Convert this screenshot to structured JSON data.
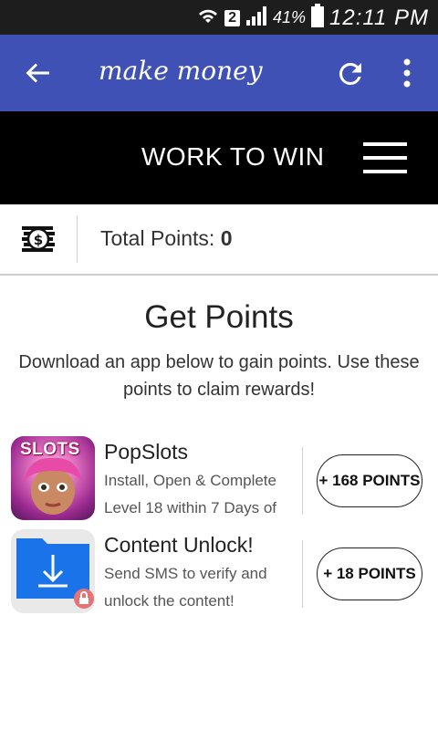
{
  "status_bar": {
    "sim": "2",
    "battery": "41%",
    "time": "12:11 PM",
    "icons": [
      "wifi-icon",
      "signal-icon",
      "battery-icon"
    ]
  },
  "app_bar": {
    "title": "make money",
    "color": "#3f51b5",
    "icons": [
      "back-arrow-icon",
      "refresh-icon",
      "more-vert-icon"
    ]
  },
  "banner": {
    "title": "WORK TO WIN",
    "menu_icon": "hamburger-icon"
  },
  "points": {
    "label": "Total Points: ",
    "value": "0",
    "icon": "money-stack-icon"
  },
  "main": {
    "heading": "Get Points",
    "description": "Download an app below to gain points. Use these points to claim rewards!"
  },
  "offers": [
    {
      "name": "PopSlots",
      "description": "Install, Open & Complete Level 18 within 7 Days of",
      "points": "+ 168 POINTS",
      "icon_text": "SLOTS",
      "icon": "popslots-app-icon"
    },
    {
      "name": "Content Unlock!",
      "description": "Send SMS to verify and unlock the content!",
      "points": "+ 18 POINTS",
      "icon": "download-lock-icon"
    }
  ]
}
